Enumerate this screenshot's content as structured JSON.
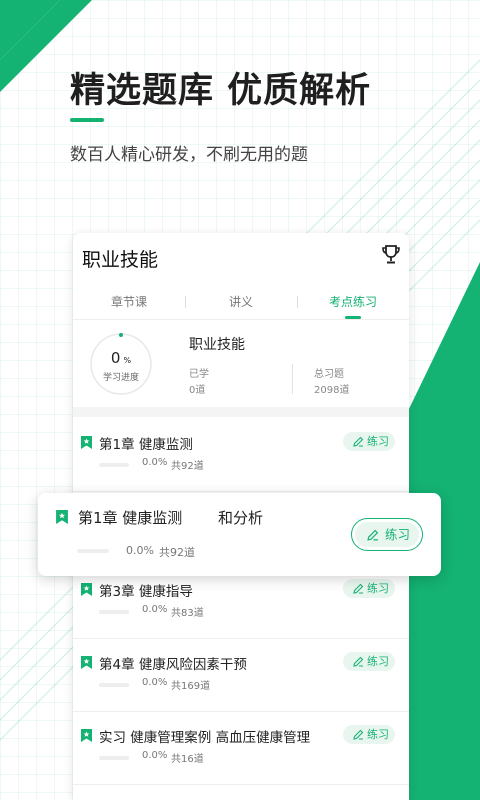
{
  "colors": {
    "accent": "#14b273",
    "accent_light": "#e9f6ef",
    "text": "#222222",
    "muted": "#777777"
  },
  "header": {
    "headline": "精选题库  优质解析",
    "subtitle": "数百人精心研发，不刷无用的题"
  },
  "card": {
    "title": "职业技能",
    "title_icon": "trophy-icon",
    "tabs": [
      {
        "label": "章节课",
        "active": false
      },
      {
        "label": "讲义",
        "active": false
      },
      {
        "label": "考点练习",
        "active": true
      }
    ],
    "summary": {
      "progress_value": "0",
      "progress_unit": "%",
      "progress_label": "学习进度",
      "name": "职业技能",
      "studied_label": "已学",
      "studied_value": "0道",
      "total_label": "总习题",
      "total_value": "2098道"
    },
    "chapters": [
      {
        "title": "第1章  健康监测",
        "percent": "0.0%",
        "count": "共92道",
        "button": "练习"
      },
      {
        "title": "",
        "percent": "",
        "count": "",
        "button": ""
      },
      {
        "title": "第3章  健康指导",
        "percent": "0.0%",
        "count": "共83道",
        "button": "练习"
      },
      {
        "title": "第4章  健康风险因素干预",
        "percent": "0.0%",
        "count": "共169道",
        "button": "练习"
      },
      {
        "title": "实习  健康管理案例  高血压健康管理",
        "percent": "0.0%",
        "count": "共16道",
        "button": "练习"
      }
    ]
  },
  "popup": {
    "title": "第1章  健康监测",
    "title_suffix": "和分析",
    "percent": "0.0%",
    "count": "共92道",
    "button": "练习"
  }
}
